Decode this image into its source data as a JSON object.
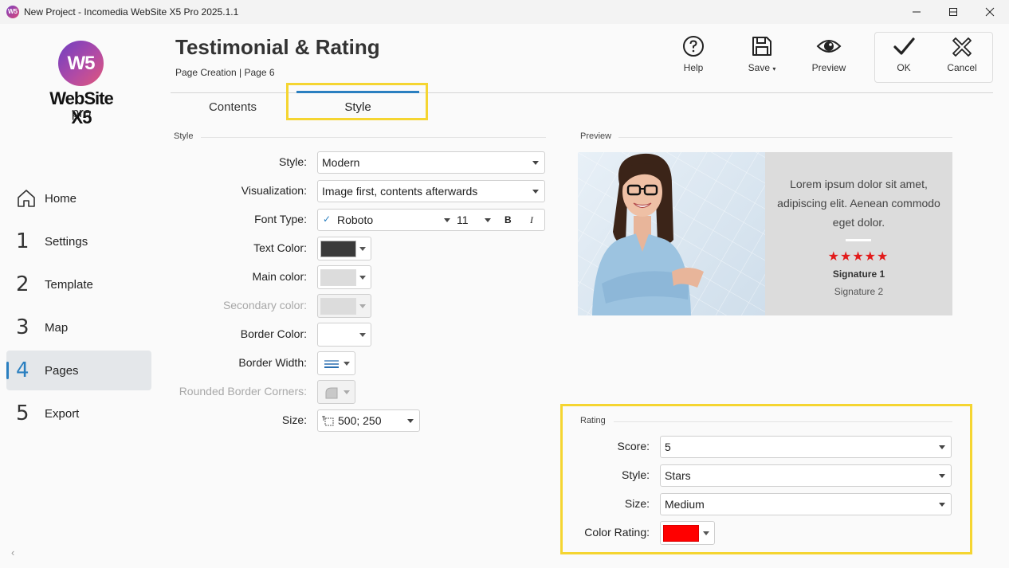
{
  "window": {
    "title": "New Project - Incomedia WebSite X5 Pro 2025.1.1",
    "app_icon_text": "W5"
  },
  "sidebar": {
    "logo_mark": "W5",
    "logo_text": "WebSite X5",
    "logo_sub": "pro",
    "items": [
      {
        "num": "",
        "label": "Home",
        "icon": "home-icon"
      },
      {
        "num": "1",
        "label": "Settings"
      },
      {
        "num": "2",
        "label": "Template"
      },
      {
        "num": "3",
        "label": "Map"
      },
      {
        "num": "4",
        "label": "Pages",
        "active": true
      },
      {
        "num": "5",
        "label": "Export"
      }
    ]
  },
  "header": {
    "title": "Testimonial & Rating",
    "breadcrumb": "Page Creation | Page 6",
    "toolbar": {
      "help": "Help",
      "save": "Save",
      "preview": "Preview",
      "ok": "OK",
      "cancel": "Cancel"
    }
  },
  "tabs": {
    "contents": "Contents",
    "style": "Style",
    "active": "Style"
  },
  "style_section": {
    "heading": "Style",
    "style_label": "Style:",
    "style_value": "Modern",
    "visualization_label": "Visualization:",
    "visualization_value": "Image first, contents afterwards",
    "font_type_label": "Font Type:",
    "font_name": "Roboto",
    "font_size": "11",
    "bold_label": "B",
    "italic_label": "I",
    "text_color_label": "Text Color:",
    "text_color": "#3a3a3a",
    "main_color_label": "Main color:",
    "main_color": "#dcdcdc",
    "secondary_color_label": "Secondary color:",
    "secondary_color": "#dcdcdc",
    "border_color_label": "Border Color:",
    "border_color": "#ffffff",
    "border_width_label": "Border Width:",
    "rounded_corners_label": "Rounded Border Corners:",
    "size_label": "Size:",
    "size_value": "500; 250"
  },
  "preview": {
    "heading": "Preview",
    "text": "Lorem ipsum dolor sit amet, adipiscing elit. Aenean commodo eget dolor.",
    "stars": "★★★★★",
    "signature1": "Signature 1",
    "signature2": "Signature 2"
  },
  "rating": {
    "heading": "Rating",
    "score_label": "Score:",
    "score_value": "5",
    "style_label": "Style:",
    "style_value": "Stars",
    "size_label": "Size:",
    "size_value": "Medium",
    "color_label": "Color Rating:",
    "color_value": "#ff0000"
  },
  "colors": {
    "accent": "#2a7fc0",
    "highlight": "#f5d531",
    "star": "#e21b1b"
  }
}
